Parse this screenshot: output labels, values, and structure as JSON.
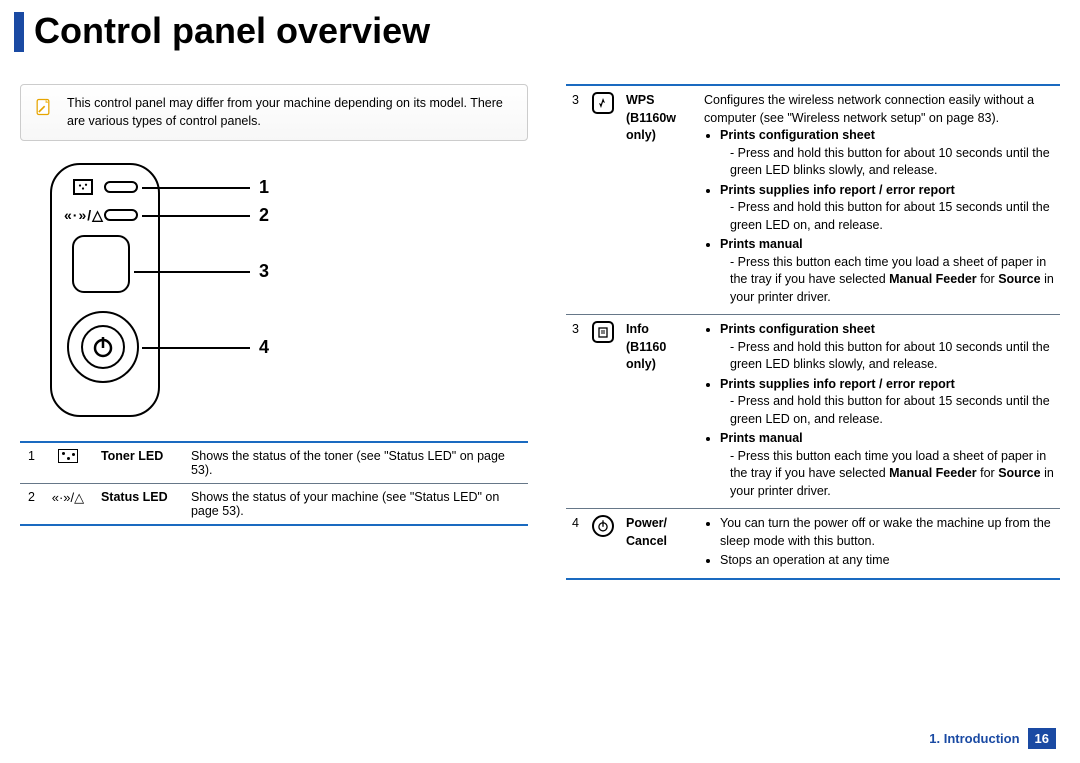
{
  "page_title": "Control panel overview",
  "note_text": "This control panel may differ from your machine depending on its model. There are various types of control panels.",
  "diagram_numbers": [
    "1",
    "2",
    "3",
    "4"
  ],
  "left_table": [
    {
      "num": "1",
      "name": "Toner LED",
      "desc": "Shows the status of the toner (see \"Status LED\" on page 53)."
    },
    {
      "num": "2",
      "name": "Status LED",
      "desc": "Shows the status of your machine (see \"Status LED\" on page 53)."
    }
  ],
  "right_table": {
    "rows": [
      {
        "num": "3",
        "name_l1": "WPS",
        "name_l2": "(B1160w only)",
        "intro": "Configures the wireless network connection easily without a computer (see \"Wireless network setup\" on page 83).",
        "sections": [
          {
            "head": "Prints configuration sheet",
            "body": "Press and hold this button for about 10 seconds until the green LED blinks slowly, and release."
          },
          {
            "head": "Prints supplies info report / error report",
            "body": "Press and hold this button for about 15 seconds until the green LED on, and release."
          },
          {
            "head": "Prints manual",
            "body_parts": [
              "Press this button each time you load a sheet of paper in the tray if you have selected ",
              "Manual Feeder",
              " for ",
              "Source",
              " in your printer driver."
            ]
          }
        ]
      },
      {
        "num": "3",
        "name_l1": "Info (B1160 only)",
        "name_l2": "",
        "sections": [
          {
            "head": "Prints configuration sheet",
            "body": "Press and hold this button for about 10 seconds until the green LED blinks slowly, and release."
          },
          {
            "head": "Prints supplies info report / error report",
            "body": "Press and hold this button for about 15 seconds until the green LED on, and release."
          },
          {
            "head": "Prints manual",
            "body_parts": [
              "Press this button each time you load a sheet of paper in the tray if you have selected ",
              "Manual Feeder",
              " for ",
              "Source",
              " in your printer driver."
            ]
          }
        ]
      },
      {
        "num": "4",
        "name_l1": "Power/",
        "name_l2": "Cancel",
        "bullets": [
          "You can turn the power off or wake the machine up from the sleep mode with this button.",
          "Stops an operation at any time"
        ]
      }
    ]
  },
  "footer_chapter": "1. Introduction",
  "footer_page": "16"
}
